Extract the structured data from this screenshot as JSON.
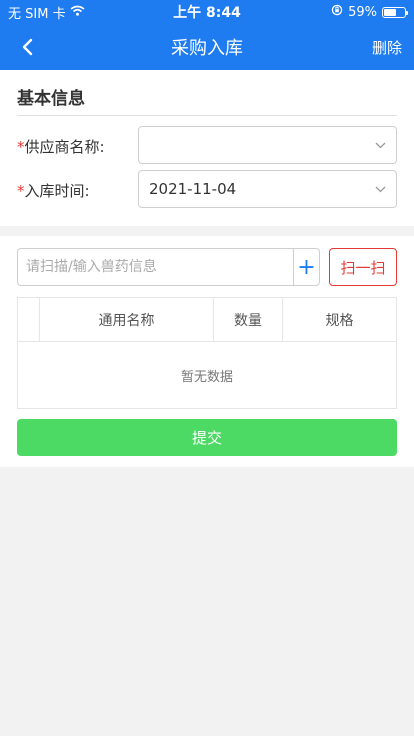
{
  "status_bar": {
    "carrier": "无 SIM 卡",
    "time": "上午 8:44",
    "battery_percent": "59%",
    "battery_level": 0.59
  },
  "nav": {
    "title": "采购入库",
    "back_icon": "chevron-left-icon",
    "action_label": "删除"
  },
  "basic_info": {
    "title": "基本信息",
    "supplier": {
      "required_mark": "*",
      "label": "供应商名称:",
      "value": ""
    },
    "inbound_time": {
      "required_mark": "*",
      "label": "入库时间:",
      "value": "2021-11-04"
    }
  },
  "goods": {
    "search_placeholder": "请扫描/输入兽药信息",
    "add_label": "+",
    "scan_label": "扫一扫",
    "table": {
      "headers": [
        "通用名称",
        "数量",
        "规格"
      ],
      "empty_text": "暂无数据"
    },
    "submit_label": "提交"
  },
  "colors": {
    "primary": "#1e7cf0",
    "danger": "#e53935",
    "success": "#4cd964",
    "background": "#f2f2f2"
  }
}
